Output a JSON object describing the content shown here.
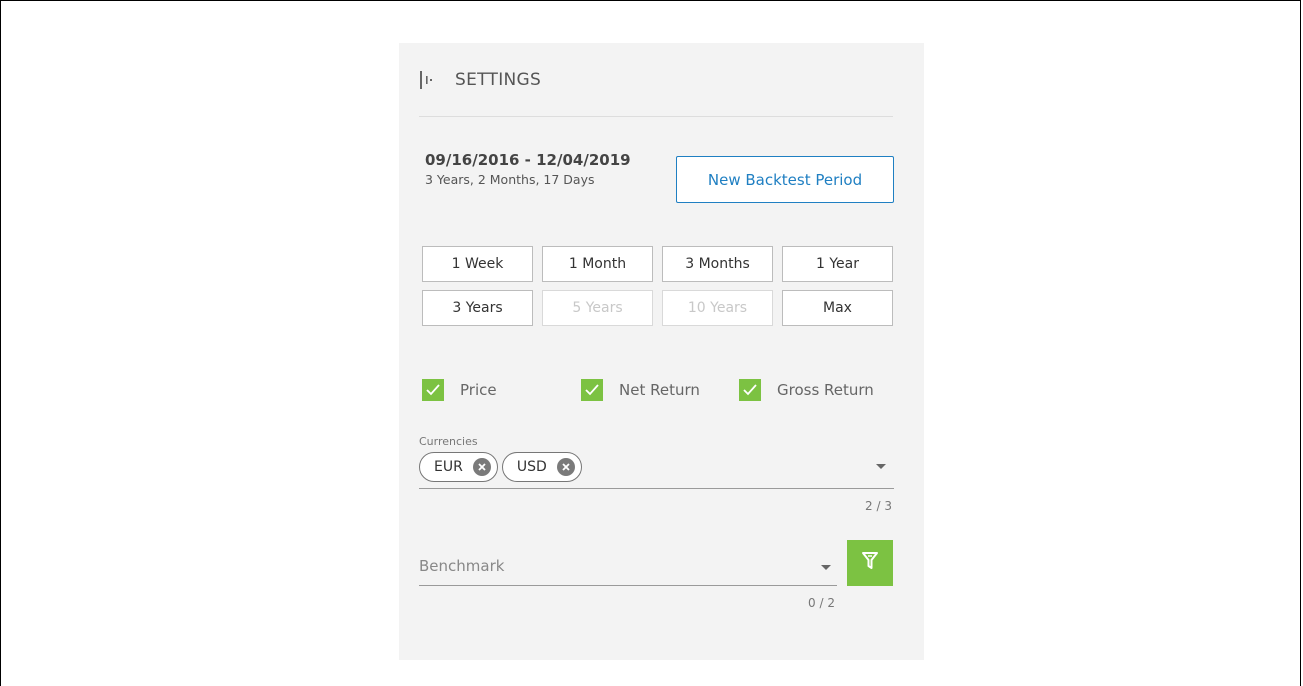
{
  "settings": {
    "title": "SETTINGS",
    "collapse_icon": "panel-collapse-icon"
  },
  "period": {
    "range": "09/16/2016 - 12/04/2019",
    "duration": "3 Years, 2 Months, 17 Days",
    "new_button_label": "New Backtest Period"
  },
  "ranges": [
    {
      "label": "1 Week",
      "enabled": true
    },
    {
      "label": "1 Month",
      "enabled": true
    },
    {
      "label": "3 Months",
      "enabled": true
    },
    {
      "label": "1 Year",
      "enabled": true
    },
    {
      "label": "3 Years",
      "enabled": true
    },
    {
      "label": "5 Years",
      "enabled": false
    },
    {
      "label": "10 Years",
      "enabled": false
    },
    {
      "label": "Max",
      "enabled": true
    }
  ],
  "return_types": [
    {
      "label": "Price",
      "checked": true
    },
    {
      "label": "Net Return",
      "checked": true
    },
    {
      "label": "Gross Return",
      "checked": true
    }
  ],
  "currencies": {
    "label": "Currencies",
    "selected": [
      "EUR",
      "USD"
    ],
    "counter": "2 / 3"
  },
  "benchmark": {
    "placeholder": "Benchmark",
    "value": "",
    "counter": "0 / 2"
  },
  "colors": {
    "accent_green": "#7cc242",
    "link_blue": "#1f7fc2",
    "panel_bg": "#f3f3f3"
  }
}
